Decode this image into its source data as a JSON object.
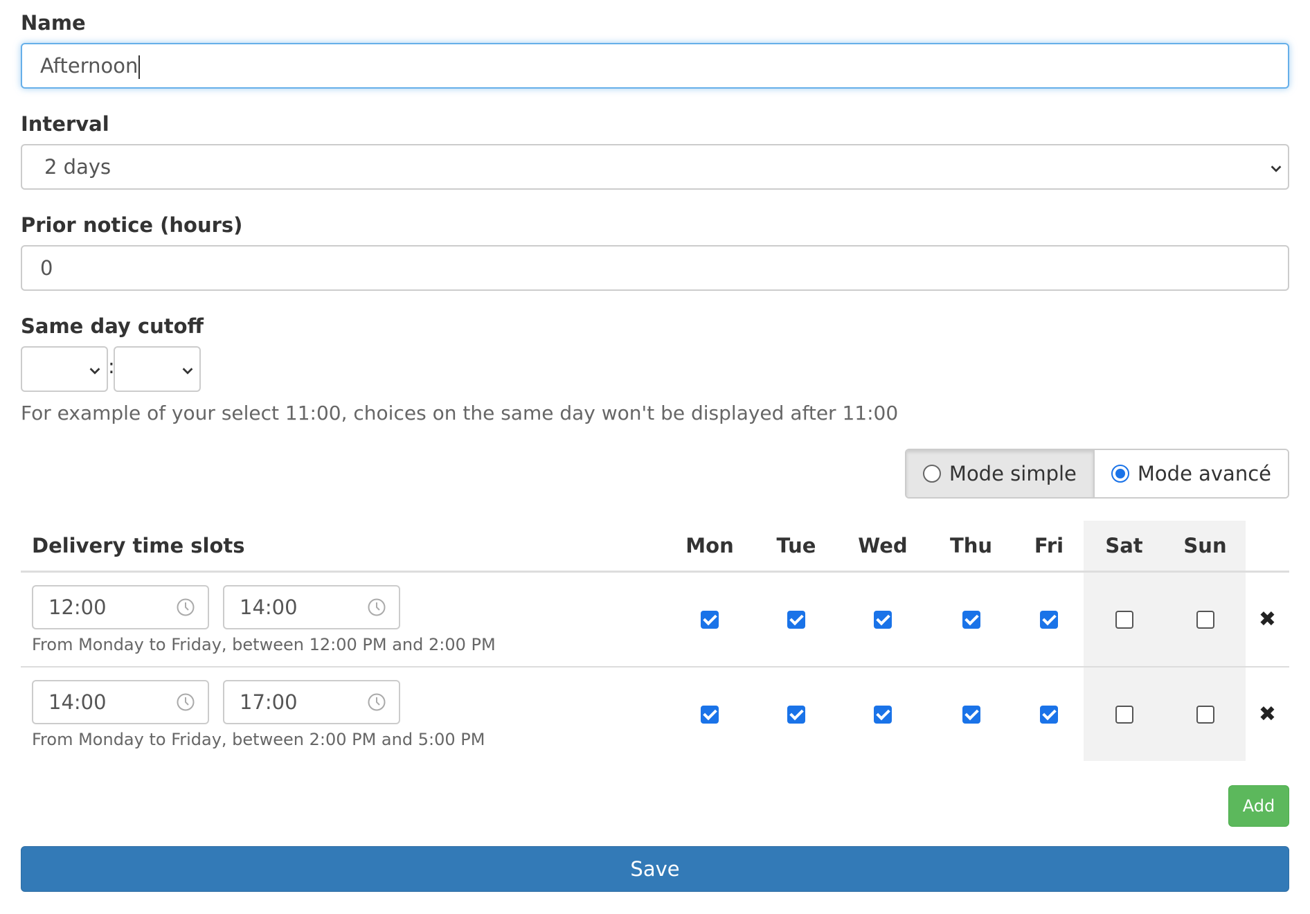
{
  "form": {
    "name_label": "Name",
    "name_value": "Afternoon",
    "interval_label": "Interval",
    "interval_value": "2 days",
    "prior_notice_label": "Prior notice (hours)",
    "prior_notice_value": "0",
    "cutoff_label": "Same day cutoff",
    "cutoff_separator": ":",
    "cutoff_help": "For example of your select 11:00, choices on the same day won't be displayed after 11:00"
  },
  "mode": {
    "simple_label": "Mode simple",
    "advanced_label": "Mode avancé",
    "selected": "advanced"
  },
  "slots_table": {
    "title": "Delivery time slots",
    "days": [
      "Mon",
      "Tue",
      "Wed",
      "Thu",
      "Fri",
      "Sat",
      "Sun"
    ],
    "delete_symbol": "✖",
    "rows": [
      {
        "start": "12:00",
        "end": "14:00",
        "help": "From Monday to Friday, between 12:00 PM and 2:00 PM",
        "checked": [
          true,
          true,
          true,
          true,
          true,
          false,
          false
        ]
      },
      {
        "start": "14:00",
        "end": "17:00",
        "help": "From Monday to Friday, between 2:00 PM and 5:00 PM",
        "checked": [
          true,
          true,
          true,
          true,
          true,
          false,
          false
        ]
      }
    ]
  },
  "buttons": {
    "add_label": "Add",
    "save_label": "Save"
  },
  "colors": {
    "save": "#337ab7",
    "add": "#5cb85c",
    "checkbox": "#1a73e8",
    "focus": "#66afe9"
  }
}
